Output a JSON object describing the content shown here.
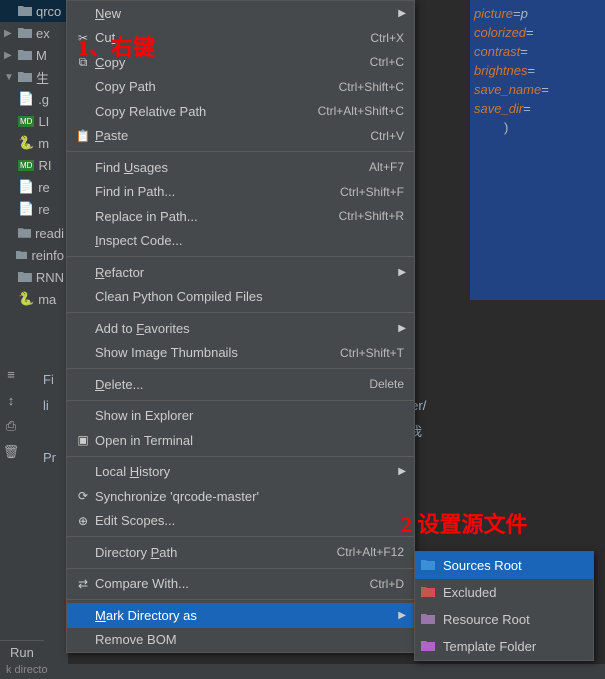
{
  "annotations": {
    "a1": "1、右键",
    "a2": "2 设置源文件"
  },
  "tree": {
    "items": [
      {
        "icon": "folder",
        "label": "qrco",
        "sel": true,
        "tri": ""
      },
      {
        "icon": "folder",
        "label": "ex",
        "tri": "▶"
      },
      {
        "icon": "folder",
        "label": "M",
        "tri": "▶"
      },
      {
        "icon": "folder",
        "label": "生",
        "tri": "▼"
      },
      {
        "icon": "file",
        "label": ".g",
        "tri": ""
      },
      {
        "icon": "md",
        "label": "LI",
        "tri": ""
      },
      {
        "icon": "py",
        "label": "m",
        "tri": ""
      },
      {
        "icon": "md",
        "label": "RI",
        "tri": ""
      },
      {
        "icon": "file",
        "label": "re",
        "tri": ""
      },
      {
        "icon": "file",
        "label": "re",
        "tri": ""
      }
    ],
    "root_items": [
      {
        "label": "readi"
      },
      {
        "label": "reinfo"
      },
      {
        "label": "RNN"
      },
      {
        "label": "ma",
        "icon": "py"
      }
    ]
  },
  "editor_right": [
    {
      "k": "picture",
      "v": "p"
    },
    {
      "k": "colorized",
      "v": ""
    },
    {
      "k": "contrast",
      "v": ""
    },
    {
      "k": "brightnes",
      "v": ""
    },
    {
      "k": "save_name",
      "v": ""
    },
    {
      "k": "save_dir",
      "v": ""
    }
  ],
  "editor_right_close": ")",
  "editor_left": {
    "l1": "Fi",
    "l2": "li",
    "l3": "Pr"
  },
  "editor_path_hint": "de-master/生成我的",
  "run_label": "Run",
  "status": "k directo",
  "menu": [
    {
      "type": "item",
      "icon": "",
      "label": "New",
      "ul": "N",
      "shortcut": "",
      "arrow": true
    },
    {
      "type": "item",
      "icon": "✂",
      "label": "Cut",
      "ul": "t",
      "shortcut": "Ctrl+X"
    },
    {
      "type": "item",
      "icon": "⧉",
      "label": "Copy",
      "ul": "C",
      "shortcut": "Ctrl+C"
    },
    {
      "type": "item",
      "icon": "",
      "label": "Copy Path",
      "shortcut": "Ctrl+Shift+C"
    },
    {
      "type": "item",
      "icon": "",
      "label": "Copy Relative Path",
      "shortcut": "Ctrl+Alt+Shift+C"
    },
    {
      "type": "item",
      "icon": "📋",
      "label": "Paste",
      "ul": "P",
      "shortcut": "Ctrl+V"
    },
    {
      "type": "sep"
    },
    {
      "type": "item",
      "icon": "",
      "label": "Find Usages",
      "ul": "U",
      "shortcut": "Alt+F7"
    },
    {
      "type": "item",
      "icon": "",
      "label": "Find in Path...",
      "ul": "",
      "shortcut": "Ctrl+Shift+F"
    },
    {
      "type": "item",
      "icon": "",
      "label": "Replace in Path...",
      "ul": "",
      "shortcut": "Ctrl+Shift+R"
    },
    {
      "type": "item",
      "icon": "",
      "label": "Inspect Code...",
      "ul": "I"
    },
    {
      "type": "sep"
    },
    {
      "type": "item",
      "icon": "",
      "label": "Refactor",
      "ul": "R",
      "arrow": true
    },
    {
      "type": "item",
      "icon": "",
      "label": "Clean Python Compiled Files"
    },
    {
      "type": "sep"
    },
    {
      "type": "item",
      "icon": "",
      "label": "Add to Favorites",
      "ul": "F",
      "arrow": true
    },
    {
      "type": "item",
      "icon": "",
      "label": "Show Image Thumbnails",
      "shortcut": "Ctrl+Shift+T"
    },
    {
      "type": "sep"
    },
    {
      "type": "item",
      "icon": "",
      "label": "Delete...",
      "ul": "D",
      "shortcut": "Delete"
    },
    {
      "type": "sep"
    },
    {
      "type": "item",
      "icon": "",
      "label": "Show in Explorer"
    },
    {
      "type": "item",
      "icon": "▣",
      "label": "Open in Terminal"
    },
    {
      "type": "sep"
    },
    {
      "type": "item",
      "icon": "",
      "label": "Local History",
      "ul": "H",
      "arrow": true
    },
    {
      "type": "item",
      "icon": "⟳",
      "label": "Synchronize 'qrcode-master'"
    },
    {
      "type": "item",
      "icon": "⊕",
      "label": "Edit Scopes..."
    },
    {
      "type": "sep"
    },
    {
      "type": "item",
      "icon": "",
      "label": "Directory Path",
      "ul": "P",
      "shortcut": "Ctrl+Alt+F12"
    },
    {
      "type": "sep"
    },
    {
      "type": "item",
      "icon": "⇄",
      "label": "Compare With...",
      "ul": "",
      "shortcut": "Ctrl+D"
    },
    {
      "type": "sep"
    },
    {
      "type": "item",
      "icon": "",
      "label": "Mark Directory as",
      "ul": "M",
      "arrow": true,
      "hl": true
    },
    {
      "type": "item",
      "icon": "",
      "label": "Remove BOM"
    }
  ],
  "submenu": [
    {
      "label": "Sources Root",
      "color": "#3b8fd9",
      "hl": true
    },
    {
      "label": "Excluded",
      "color": "#c75450"
    },
    {
      "label": "Resource Root",
      "color": "#9876aa"
    },
    {
      "label": "Template Folder",
      "color": "#b064c9"
    }
  ]
}
